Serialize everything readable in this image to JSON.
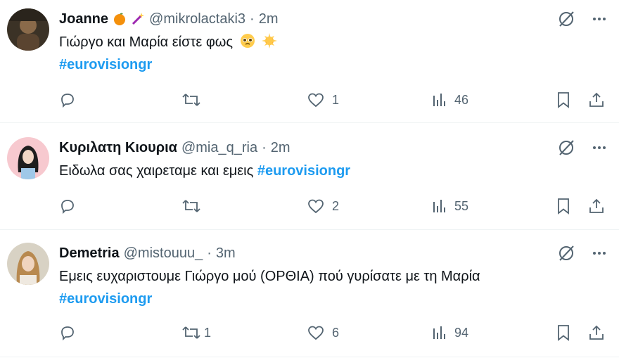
{
  "tweets": [
    {
      "name": "Joanne",
      "handle": "@mikrolactaki3",
      "dot": "·",
      "time": "2m",
      "line1": "Γιώργο και Μαρία είστε φως",
      "hashtag": "#eurovisiongr",
      "replies": "",
      "retweets": "",
      "likes": "1",
      "views": "46"
    },
    {
      "name": "Κυριλατη Κιουρια",
      "handle": "@mia_q_ria",
      "dot": "·",
      "time": "2m",
      "line1": "Ειδωλα σας χαιρεταμε και εμεις",
      "hashtag": "#eurovisiongr",
      "replies": "",
      "retweets": "",
      "likes": "2",
      "views": "55"
    },
    {
      "name": "Demetria",
      "handle": "@mistouuu_",
      "dot": "·",
      "time": "3m",
      "line1": "Εμεις ευχαριστουμε Γιώργο μού (ΟΡΘΙΑ) πού γυρίσατε με τη Μαρία",
      "hashtag": "#eurovisiongr",
      "replies": "",
      "retweets": "1",
      "likes": "6",
      "views": "94"
    }
  ],
  "colors": {
    "accent": "#1d9bf0",
    "muted": "#536471",
    "text": "#0f1419",
    "divider": "#eff3f4"
  },
  "icons": [
    "reply-icon",
    "retweet-icon",
    "like-icon",
    "views-icon",
    "bookmark-icon",
    "share-icon",
    "grok-icon",
    "more-icon",
    "orange-emoji-icon",
    "magic-wand-emoji-icon",
    "pleading-face-emoji-icon",
    "star-emoji-icon"
  ]
}
